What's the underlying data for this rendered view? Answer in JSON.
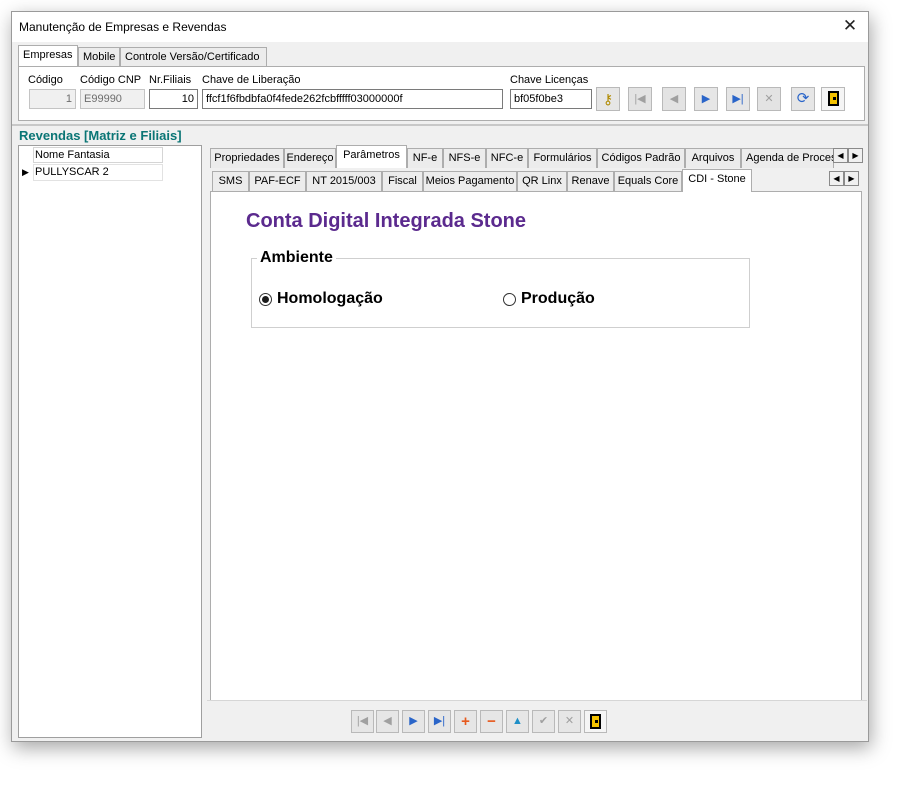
{
  "window": {
    "title": "Manutenção de Empresas e Revendas",
    "close_glyph": "✕"
  },
  "top_tabs": [
    "Empresas",
    "Mobile",
    "Controle Versão/Certificado"
  ],
  "fields": {
    "codigo_label": "Código",
    "codigo_value": "1",
    "codigo_cnp_label": "Código CNP",
    "codigo_cnp_value": "E99990",
    "nr_filiais_label": "Nr.Filiais",
    "nr_filiais_value": "10",
    "chave_liberacao_label": "Chave de Liberação",
    "chave_liberacao_value": "ffcf1f6fbdbfa0f4fede262fcbfffff03000000f",
    "chave_licencas_label": "Chave Licenças",
    "chave_licencas_value": "bf05f0be3"
  },
  "toolbar_icons": {
    "key": "key-icon",
    "first": "|◀",
    "prev": "◀",
    "next": "▶",
    "last": "▶|",
    "cancel": "✕",
    "refresh": "⟳"
  },
  "section_title": "Revendas [Matriz e Filiais]",
  "grid": {
    "column_header": "Nome Fantasia",
    "rows": [
      "PULLYSCAR 2"
    ],
    "row_indicator": "▶"
  },
  "tabs_level1": [
    "Propriedades",
    "Endereço",
    "Parâmetros",
    "NF-e",
    "NFS-e",
    "NFC-e",
    "Formulários",
    "Códigos Padrão",
    "Arquivos",
    "Agenda de Proces"
  ],
  "tabs_level2": [
    "SMS",
    "PAF-ECF",
    "NT 2015/003",
    "Fiscal",
    "Meios Pagamento",
    "QR Linx",
    "Renave",
    "Equals Core",
    "CDI - Stone"
  ],
  "scroll_arrows": {
    "left": "◀",
    "right": "▶"
  },
  "cdi": {
    "title": "Conta Digital Integrada Stone",
    "group_label": "Ambiente",
    "options": [
      {
        "label": "Homologação",
        "checked": true
      },
      {
        "label": "Produção",
        "checked": false
      }
    ]
  },
  "bottom_buttons": {
    "first": "|◀",
    "prev": "◀",
    "next": "▶",
    "last": "▶|",
    "add": "+",
    "remove": "−",
    "up": "▲",
    "confirm": "✔",
    "cancel": "✕"
  },
  "colors": {
    "section_title": "#0a7575",
    "cdi_title": "#5b2a8e",
    "nav_blue": "#2a65c9",
    "add_remove": "#e65a1e"
  }
}
